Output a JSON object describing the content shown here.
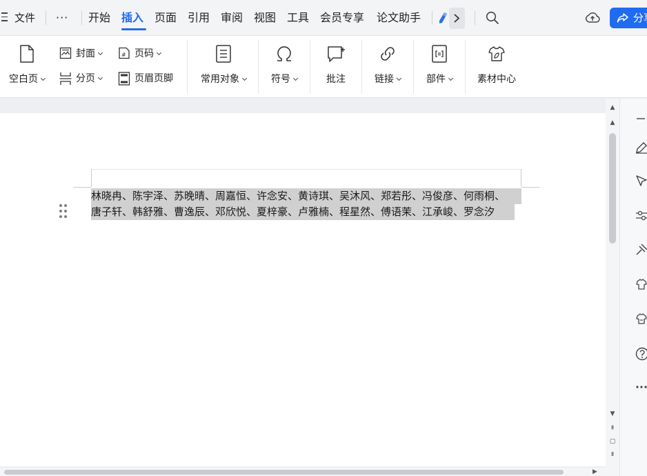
{
  "menubar": {
    "file_label": "文件",
    "more_label": "···",
    "tabs": [
      {
        "label": "开始"
      },
      {
        "label": "插入"
      },
      {
        "label": "页面"
      },
      {
        "label": "引用"
      },
      {
        "label": "审阅"
      },
      {
        "label": "视图"
      },
      {
        "label": "工具"
      },
      {
        "label": "会员专享"
      },
      {
        "label": "论文助手"
      }
    ],
    "active_tab": "插入",
    "share_label": "分享"
  },
  "ribbon": {
    "blank_page": "空白页",
    "cover": "封面",
    "page_number": "页码",
    "page_break": "分页",
    "header_footer": "页眉页脚",
    "common_objects": "常用对象",
    "symbol": "符号",
    "comment": "批注",
    "link": "链接",
    "parts": "部件",
    "material_center": "素材中心"
  },
  "document": {
    "lines": [
      "林晓冉、陈宇泽、苏晚晴、周嘉恒、许念安、黄诗琪、吴沐风、郑若彤、冯俊彦、何雨桐、",
      "唐子轩、韩舒雅、曹逸辰、邓欣悦、夏梓豪、卢雅楠、程星然、傅语茉、江承峻、罗念汐"
    ]
  },
  "colors": {
    "accent": "#1f6cf0",
    "selection": "#d0d0d0",
    "menubar_bg": "#f3f4f6",
    "canvas_bg": "#eeeff2"
  },
  "icons": [
    "menu-icon",
    "pen-icon",
    "chevron-right-icon",
    "search-icon",
    "cloud-upload-icon",
    "share-icon",
    "blank-page-icon",
    "cover-icon",
    "page-number-icon",
    "page-break-icon",
    "header-footer-icon",
    "common-objects-icon",
    "omega-icon",
    "comment-icon",
    "link-icon",
    "parts-icon",
    "material-icon"
  ]
}
